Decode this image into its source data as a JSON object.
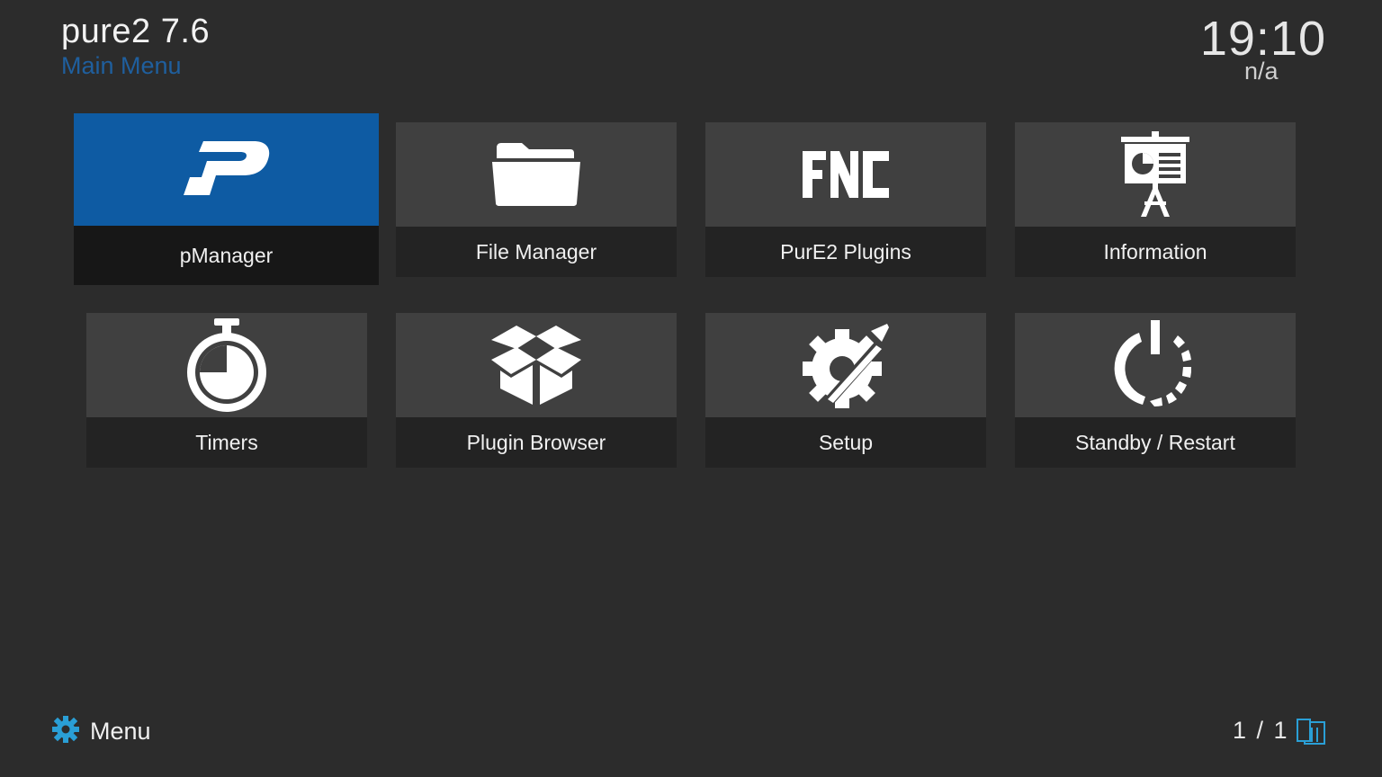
{
  "header": {
    "title": "pure2 7.6",
    "subtitle": "Main Menu",
    "time": "19:10",
    "time_sub": "n/a"
  },
  "tiles": [
    {
      "label": "pManager",
      "icon": "p-logo-icon",
      "selected": true
    },
    {
      "label": "File Manager",
      "icon": "folder-icon",
      "selected": false
    },
    {
      "label": "PurE2 Plugins",
      "icon": "fnc-logo-icon",
      "selected": false
    },
    {
      "label": "Information",
      "icon": "presentation-board-icon",
      "selected": false
    },
    {
      "label": "Timers",
      "icon": "stopwatch-icon",
      "selected": false
    },
    {
      "label": "Plugin Browser",
      "icon": "open-box-icon",
      "selected": false
    },
    {
      "label": "Setup",
      "icon": "gear-tools-icon",
      "selected": false
    },
    {
      "label": "Standby / Restart",
      "icon": "power-icon",
      "selected": false
    }
  ],
  "footer": {
    "menu_label": "Menu",
    "menu_icon": "gear-icon",
    "page_counter": "1 / 1",
    "page_icon": "pages-icon"
  },
  "colors": {
    "background": "#2c2c2c",
    "accent": "#0e5ba3",
    "subtitle": "#1f5f9e",
    "footer_icon": "#2a9fd6"
  }
}
